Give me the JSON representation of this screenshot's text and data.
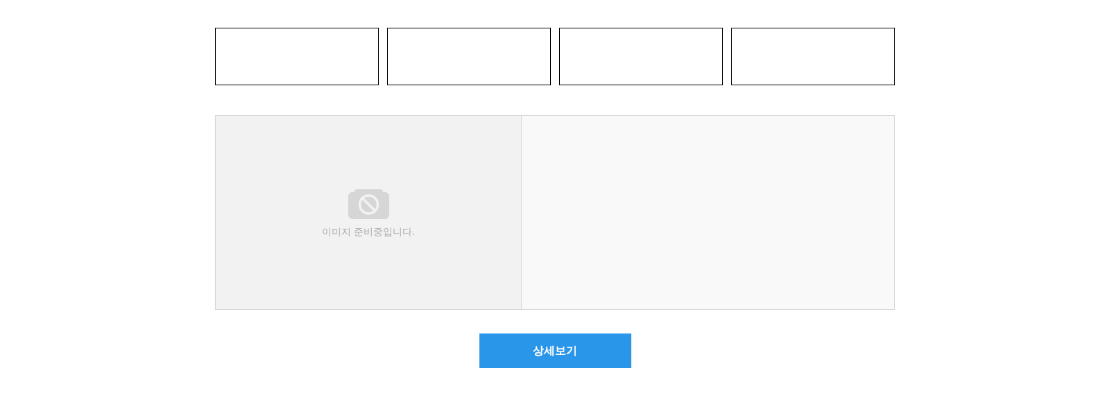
{
  "boxes": [
    {
      "kind": "empty"
    },
    {
      "kind": "empty"
    },
    {
      "kind": "empty"
    },
    {
      "kind": "empty"
    }
  ],
  "product": {
    "image": {
      "kind": "placeholder",
      "message": "이미지 준비중입니다."
    }
  },
  "detail_button": "상세보기"
}
